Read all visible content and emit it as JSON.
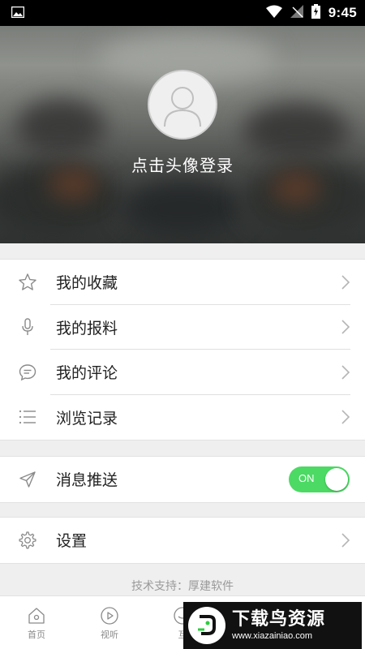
{
  "status_bar": {
    "time": "9:45"
  },
  "profile": {
    "login_prompt": "点击头像登录"
  },
  "menu_group_1": [
    {
      "label": "我的收藏",
      "icon": "star-icon"
    },
    {
      "label": "我的报料",
      "icon": "microphone-icon"
    },
    {
      "label": "我的评论",
      "icon": "comment-icon"
    },
    {
      "label": "浏览记录",
      "icon": "list-icon"
    }
  ],
  "push": {
    "label": "消息推送",
    "icon": "send-icon",
    "toggle_text": "ON",
    "enabled": true
  },
  "settings": {
    "label": "设置",
    "icon": "gear-icon"
  },
  "footer": {
    "support_text": "技术支持：厚建软件"
  },
  "bottom_nav": [
    {
      "label": "首页",
      "icon": "home-icon"
    },
    {
      "label": "视听",
      "icon": "play-icon"
    },
    {
      "label": "互",
      "icon": "interact-icon"
    }
  ],
  "watermark": {
    "title": "下载鸟资源",
    "url": "www.xiazainiao.com"
  },
  "colors": {
    "toggle_on": "#4cd964",
    "background": "#efefef"
  }
}
